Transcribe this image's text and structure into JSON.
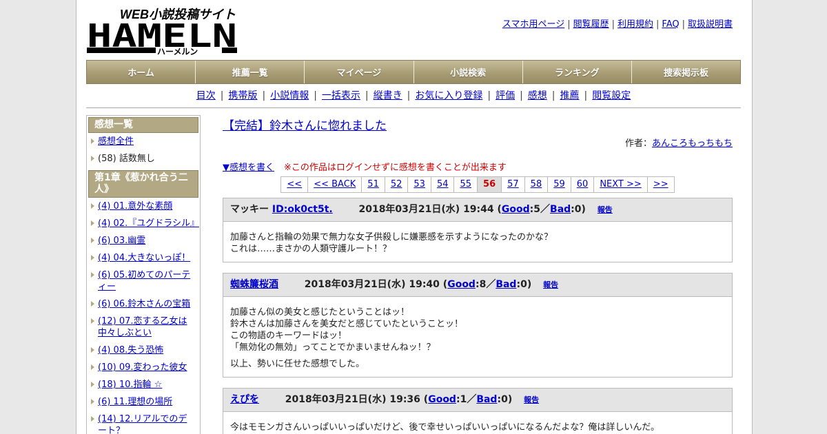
{
  "header": {
    "logo_main": "HAMELN",
    "logo_top": "WEB小説投稿サイト",
    "logo_sub": "ハーメルン",
    "top_links": [
      "スマホ用ページ",
      "閲覧履歴",
      "利用規約",
      "FAQ",
      "取扱説明書"
    ]
  },
  "nav": [
    "ホーム",
    "推薦一覧",
    "マイページ",
    "小説検索",
    "ランキング",
    "捜索掲示板"
  ],
  "subnav": [
    "目次",
    "携帯版",
    "小説情報",
    "一括表示",
    "縦書き",
    "お気に入り登録",
    "評価",
    "感想",
    "推薦",
    "閲覧設定"
  ],
  "sidebar": {
    "head1": "感想一覧",
    "all": "感想全件",
    "no_episode": "(58) 話数無し",
    "head2": "第1章《惹かれ合う二人》",
    "items": [
      "(4) 01.意外な素顔",
      "(4) 02.『ユグドラシル』",
      "(6) 03.幽霊",
      "(4) 04.大きないっぽ！",
      "(6) 05.初めてのパーティー",
      "(6) 06.鈴木さんの宝箱",
      "(12) 07.恋する乙女は中々しぶとい",
      "(4) 08.失う恐怖",
      "(10) 09.変わった彼女",
      "(18) 10.指輪 ☆",
      "(6) 11.理想の場所",
      "(14) 12.リアルでのデート？"
    ]
  },
  "main": {
    "title": "【完結】鈴木さんに惚れました",
    "author_label": "作者：",
    "author": "あんころもっちもち",
    "write_link": "▼感想を書く",
    "notice": "※この作品はログインせずに感想を書くことが出来ます",
    "pager": [
      "<<",
      "<< BACK",
      "51",
      "52",
      "53",
      "54",
      "55",
      "56",
      "57",
      "58",
      "59",
      "60",
      "NEXT >>",
      ">>"
    ],
    "current_page": "56"
  },
  "reviews": [
    {
      "name": "マッキー",
      "id": "ID:ok0ct5t.",
      "date": "2018年03月21日(水) 19:44",
      "good": "5",
      "bad": "0",
      "body": [
        "加藤さんと指輪の効果で無力な女子供殺しに嫌悪感を示すようになったのかな？",
        "これは……まさかの人類守護ルート！？"
      ]
    },
    {
      "name": "蜘蛛簾桜酒",
      "date": "2018年03月21日(水) 19:40",
      "good": "8",
      "bad": "0",
      "body": [
        "加藤さん似の美女と感じたということはッ！",
        "鈴木さんは加藤さんを美女だと感じていたということッ！",
        "この物語のキーワードはッ！",
        "「無効化の無効」ってことでかまいませんねッ！？",
        "",
        "以上、勢いに任せた感想でした。"
      ]
    },
    {
      "name": "えぴを",
      "date": "2018年03月21日(水) 19:36",
      "good": "1",
      "bad": "0",
      "body": [
        "今はモモンガさんいっぱいいっぱいだけど、後で幸せいっぱいいっぱいになるんだよな？俺は詳しいんだ。"
      ]
    }
  ],
  "labels": {
    "good": "Good",
    "bad": "Bad",
    "report": "報告"
  }
}
